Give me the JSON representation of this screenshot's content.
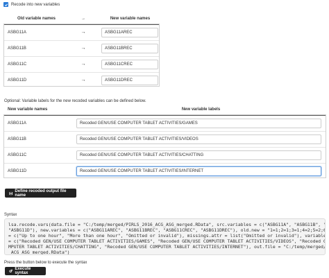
{
  "recode": {
    "label": "Recode into new variables",
    "checked": true
  },
  "table1": {
    "headers": {
      "old": "Old variable names",
      "arrow": "→",
      "new": "New variable names"
    },
    "rows": [
      {
        "old": "ASBG11A",
        "arrow": "→",
        "new": "ASBG11AREC"
      },
      {
        "old": "ASBG11B",
        "arrow": "→",
        "new": "ASBG11BREC"
      },
      {
        "old": "ASBG11C",
        "arrow": "→",
        "new": "ASBG11CREC"
      },
      {
        "old": "ASBG11D",
        "arrow": "→",
        "new": "ASBG11DREC"
      }
    ]
  },
  "optional_text": "Optional: Variable labels for the new recoded variables can be defined below.",
  "table2": {
    "headers": {
      "old": "New variable names",
      "new": "New variable labels"
    },
    "rows": [
      {
        "name": "ASBG11A",
        "label": "Recoded GEN/USE COMPUTER TABLET ACTIVITIES/GAMES"
      },
      {
        "name": "ASBG11B",
        "label": "Recoded GEN/USE COMPUTER TABLET ACTIVITIES/VIDEOS"
      },
      {
        "name": "ASBG11C",
        "label": "Recoded GEN/USE COMPUTER TABLET ACTIVITIES/CHATTING"
      },
      {
        "name": "ASBG11D",
        "label": "Recoded GEN/USE COMPUTER TABLET ACTIVITIES/INTERNET"
      }
    ]
  },
  "define_button": "Define recoded output file name",
  "syntax_label": "Syntax",
  "syntax_lines": [
    "lsa.recode.vars(data.file = \"C:/temp/merged/PIRLS_2016_ACG_ASG_merged.RData\", src.variables = c(\"ASBG11A\", \"ASBG11B\", \"ASBG11C\",",
    "\"ASBG11D\"), new.variables = c(\"ASBG11AREC\", \"ASBG11BREC\", \"ASBG11CREC\", \"ASBG11DREC\"), old.new = \"1=1;2=1;3=1;4=2;5=2;6=3\", new.labels",
    "= c(\"Up to one hour\", \"More than one hour\", \"Omitted or invalid\"), missings.attr = list(\"Omitted or invalid\"), variable.labels",
    "= c(\"Recoded GEN/USE COMPUTER TABLET ACTIVITIES/GAMES\", \"Recoded GEN/USE COMPUTER TABLET ACTIVITIES/VIDEOS\", \"Recoded GEN/USE CO",
    "MPUTER TABLET ACTIVITIES/CHATTING\", \"Recoded GEN/USE COMPUTER TABLET ACTIVITIES/INTERNET\"), out.file = \"C:/temp/merged/PIRLS_2016",
    "_ACG_ASG_merged.RData\")"
  ],
  "exec_label": "Press the button below to execute the syntax",
  "exec_button": "Execute syntax",
  "colors": {
    "checkbox": "#2a7bd6",
    "button_bg": "#222222",
    "syntax_bg": "#f4f4f4",
    "focus_border": "#6aa0e0"
  },
  "icons": {
    "checkbox": "check-icon",
    "arrow": "right-arrow-icon",
    "define": "save-icon",
    "exec": "cogs-icon"
  }
}
